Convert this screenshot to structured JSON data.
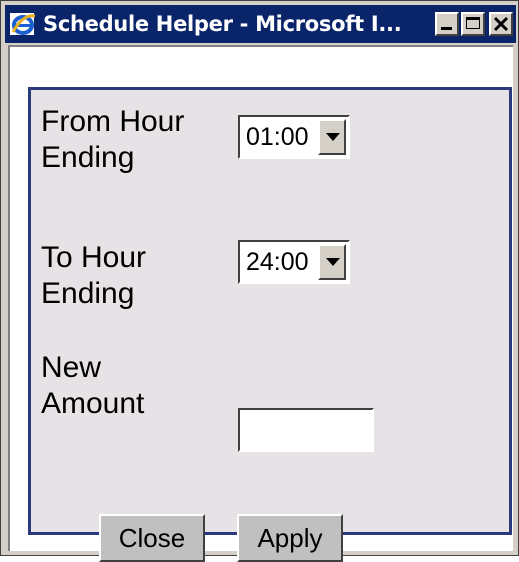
{
  "window": {
    "title": "Schedule Helper - Microsoft I...",
    "title_icon": "ie-icon",
    "controls": {
      "minimize_icon": "minimize-icon",
      "maximize_icon": "maximize-icon",
      "close_icon": "close-icon"
    },
    "colors": {
      "titlebar": "#0a246a",
      "panel_bg": "#e6e2e6",
      "panel_border": "#2b3a7a"
    }
  },
  "form": {
    "from_hour": {
      "label_line1": "From Hour",
      "label_line2": "Ending",
      "value": "01:00"
    },
    "to_hour": {
      "label_line1": "To Hour",
      "label_line2": "Ending",
      "value": "24:00"
    },
    "new_amount": {
      "label_line1": "New",
      "label_line2": "Amount",
      "value": ""
    },
    "close_label": "Close",
    "apply_label": "Apply"
  }
}
